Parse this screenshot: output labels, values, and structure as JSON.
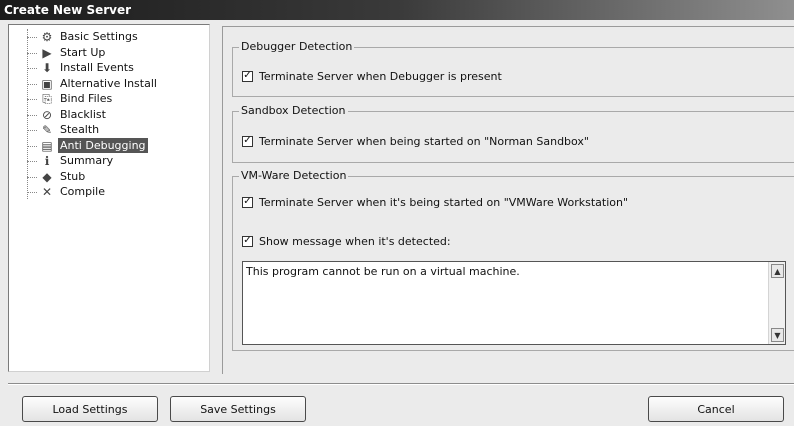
{
  "window": {
    "title": "Create New Server"
  },
  "tree": {
    "items": [
      {
        "label": "Basic Settings",
        "icon": "settings-icon",
        "glyph": "⚙"
      },
      {
        "label": "Start Up",
        "icon": "startup-icon",
        "glyph": "▶"
      },
      {
        "label": "Install Events",
        "icon": "install-icon",
        "glyph": "⬇"
      },
      {
        "label": "Alternative Install",
        "icon": "computer-icon",
        "glyph": "▣"
      },
      {
        "label": "Bind Files",
        "icon": "bind-files-icon",
        "glyph": "⎘"
      },
      {
        "label": "Blacklist",
        "icon": "blacklist-icon",
        "glyph": "⊘"
      },
      {
        "label": "Stealth",
        "icon": "stealth-icon",
        "glyph": "✎"
      },
      {
        "label": "Anti Debugging",
        "icon": "anti-debugging-icon",
        "glyph": "▤",
        "selected": true
      },
      {
        "label": "Summary",
        "icon": "summary-icon",
        "glyph": "ℹ"
      },
      {
        "label": "Stub",
        "icon": "stub-icon",
        "glyph": "◆"
      },
      {
        "label": "Compile",
        "icon": "compile-icon",
        "glyph": "✕"
      }
    ]
  },
  "debugger": {
    "title": "Debugger Detection",
    "terminate_label": "Terminate Server when Debugger is present",
    "terminate_checked": true
  },
  "sandbox": {
    "title": "Sandbox Detection",
    "terminate_label": "Terminate Server when being started on \"Norman Sandbox\"",
    "terminate_checked": true
  },
  "vmware": {
    "title": "VM-Ware Detection",
    "terminate_label": "Terminate Server when it's being started on \"VMWare Workstation\"",
    "terminate_checked": true,
    "show_message_label": "Show message when it's detected:",
    "show_message_checked": true,
    "message": "This program cannot be run on a virtual machine."
  },
  "footer": {
    "load_label": "Load Settings",
    "save_label": "Save Settings",
    "cancel_label": "Cancel"
  }
}
